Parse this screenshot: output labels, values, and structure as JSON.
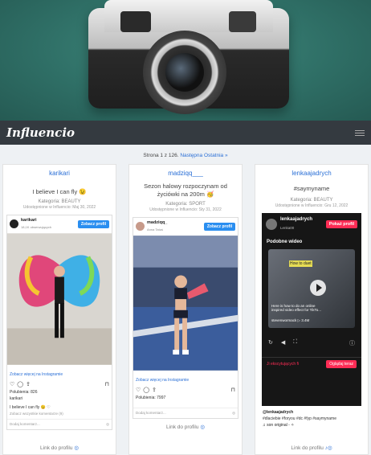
{
  "nav": {
    "logo": "Influencio",
    "menu_icon": "hamburger-icon"
  },
  "pager": {
    "text": "Strona 1 z 126.",
    "next": "Następna",
    "last": "Ostatnia »"
  },
  "cards": [
    {
      "title": "karikari",
      "headline": "I believe I can fly 😉",
      "category": "Kategoria: BEAUTY",
      "date": "Udostępnione w Influencio: Maj 30, 2022",
      "embed": {
        "user": "karikari",
        "followers": "18,1K obserwujących",
        "profile_btn": "Zobacz profil",
        "more_link": "Zobacz więcej na Instagramie",
        "likes": "Polubienia: 826",
        "author": "karikari",
        "caption": "I believe I can fly 😉 ♡",
        "comments": "Zobacz wszystkie komentarze (9)",
        "add_comment": "Dodaj komentarz..."
      },
      "profile_link": "Link do profilu"
    },
    {
      "title": "madziqq___",
      "headline": "Sezon halowy rozpoczynam od życiówki na 200m 🥳",
      "category": "Kategoria: SPORT",
      "date": "Udostępnione w Influencio: Sty 31, 2022",
      "embed": {
        "user": "madziqq_",
        "followers": "Anna Tatuś",
        "profile_btn": "Zobacz profil",
        "more_link": "Zobacz więcej na Instagramie",
        "likes": "Polubienia: 7997",
        "add_comment": "Dodaj komentarz..."
      },
      "profile_link": "Link do profilu"
    },
    {
      "title": "lenkaajadrych",
      "headline": "#saymyname",
      "category": "Kategoria: BEAUTY",
      "date": "Udostępnione w Influencio: Gru 12, 2022",
      "embed": {
        "user": "lenkaajadrych",
        "sub": "Lenka00",
        "profile_btn": "Pokaż profil",
        "similar": "Podobne wideo",
        "video_tag": "How to duet",
        "video_desc": "Here is how to do an online inspired video effect for TikTo...",
        "video_meta": "stevenwormack  ▷ 3.4M",
        "bar_text": "Ji ekscytujących fi",
        "watch_btn": "Oglądaj teraz",
        "handle": "@lenkaajadrych",
        "tags": "#dlaciebie #foryou #dc #fyp #saymyname",
        "sound": "♫ son original - ✧"
      },
      "profile_link": "Link do profilu"
    }
  ]
}
